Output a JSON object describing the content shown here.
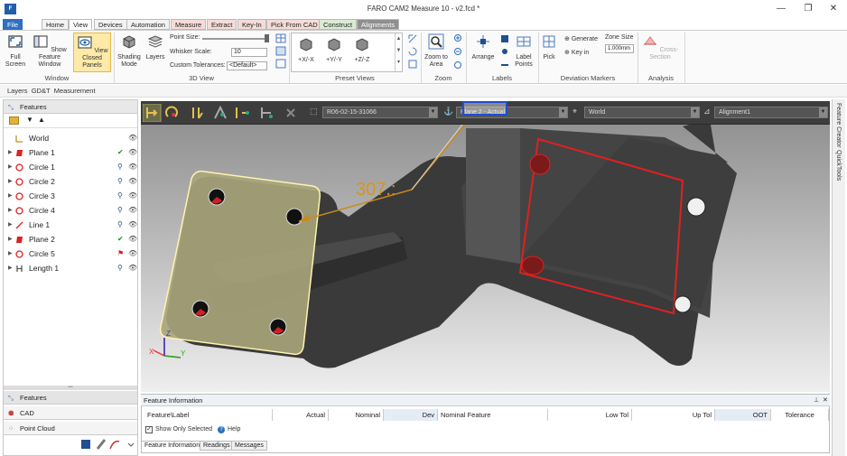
{
  "window": {
    "title": "FARO CAM2 Measure 10 - v2.fcd *",
    "app_icon_text": "F",
    "minimize": "—",
    "maximize": "❐",
    "close": "✕"
  },
  "tabs": [
    "File",
    "Home",
    "View",
    "Devices",
    "Automation",
    "Measure",
    "Extract",
    "Key-In",
    "Pick From CAD",
    "Construct",
    "Alignments"
  ],
  "active_tab": "View",
  "ribbon": {
    "window_group": {
      "label": "Window",
      "full_screen": "Full Screen",
      "show_feature_window": "Show Feature Window",
      "view_closed_panels": "View Closed Panels"
    },
    "view3d_group": {
      "label": "3D View",
      "shading_mode": "Shading Mode",
      "layers": "Layers",
      "point_size_label": "Point Size:",
      "whisker_scale_label": "Whisker Scale:",
      "whisker_scale_value": "10",
      "custom_tolerances_label": "Custom Tolerances:",
      "custom_tolerances_value": "<Default>"
    },
    "preset_views": {
      "label": "Preset Views",
      "items": [
        "+X/-X",
        "+Y/-Y",
        "+Z/-Z"
      ]
    },
    "zoom_group": {
      "label": "Zoom",
      "zoom_to_area": "Zoom to Area"
    },
    "labels_group": {
      "label": "Labels",
      "arrange": "Arrange",
      "label_points": "Label Points"
    },
    "deviation_group": {
      "label": "Deviation Markers",
      "pick": "Pick",
      "generate": "Generate",
      "key_in": "Key in",
      "zone_size_label": "Zone Size",
      "zone_size_value": "1.000mm"
    },
    "analysis_group": {
      "label": "Analysis",
      "cross_section": "Cross-Section"
    }
  },
  "breadcrumb": [
    "Layers",
    "GD&T",
    "Measurement"
  ],
  "left_panel": {
    "features_title": "Features",
    "tree": [
      {
        "label": "World",
        "icon": "world-axis-icon",
        "status": ""
      },
      {
        "label": "Plane 1",
        "icon": "plane-icon",
        "status": "check"
      },
      {
        "label": "Circle 1",
        "icon": "circle-icon",
        "status": "pin"
      },
      {
        "label": "Circle 2",
        "icon": "circle-icon",
        "status": "pin"
      },
      {
        "label": "Circle 3",
        "icon": "circle-icon",
        "status": "pin"
      },
      {
        "label": "Circle 4",
        "icon": "circle-icon",
        "status": "pin"
      },
      {
        "label": "Line 1",
        "icon": "line-icon",
        "status": "pin"
      },
      {
        "label": "Plane 2",
        "icon": "plane-icon",
        "status": "check"
      },
      {
        "label": "Circle 5",
        "icon": "circle-icon",
        "status": "flag"
      },
      {
        "label": "Length 1",
        "icon": "length-icon",
        "status": "pin"
      }
    ],
    "bottom_tabs": [
      "Features",
      "CAD",
      "Point Cloud"
    ]
  },
  "viewport": {
    "combo_1": "R06-02-15-31066",
    "combo_2": "Plane 2 - Actual",
    "combo_3": "World",
    "combo_4": "Alignment1",
    "measure_label": "307.:",
    "axis_x": "X",
    "axis_y": "Y",
    "axis_z": "Z"
  },
  "right_strip": [
    "Feature Creator",
    "QuickTools"
  ],
  "feature_info": {
    "title": "Feature Information",
    "columns": [
      "Feature\\Label",
      "Actual",
      "Nominal",
      "Dev",
      "Nominal Feature",
      "Low Tol",
      "Up Tol",
      "OOT",
      "Tolerance"
    ],
    "show_only_selected": "Show Only Selected",
    "help": "Help",
    "bottom_tabs": [
      "Feature Information",
      "Readings",
      "Messages"
    ]
  }
}
